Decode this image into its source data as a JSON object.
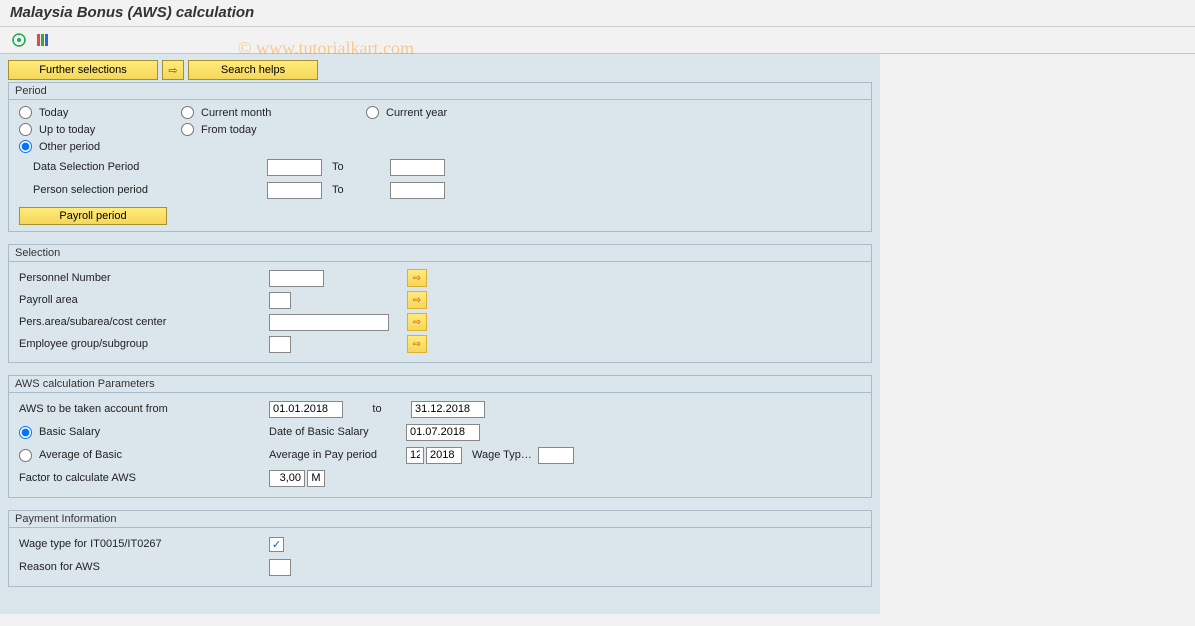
{
  "title": "Malaysia Bonus (AWS) calculation",
  "watermark": "© www.tutorialkart.com",
  "toolbar": {
    "execute_icon": "execute",
    "variant_icon": "variants"
  },
  "top_buttons": {
    "further": "Further selections",
    "search_helps": "Search helps"
  },
  "period": {
    "title": "Period",
    "today": "Today",
    "current_month": "Current month",
    "current_year": "Current year",
    "up_to_today": "Up to today",
    "from_today": "From today",
    "other_period": "Other period",
    "data_sel": "Data Selection Period",
    "person_sel": "Person selection period",
    "to": "To",
    "payroll_btn": "Payroll period",
    "data_from": "",
    "data_to": "",
    "person_from": "",
    "person_to": ""
  },
  "selection": {
    "title": "Selection",
    "personnel_number": "Personnel Number",
    "payroll_area": "Payroll area",
    "pers_area": "Pers.area/subarea/cost center",
    "emp_group": "Employee group/subgroup",
    "pn_val": "",
    "pa_val": "",
    "parea_val": "",
    "eg_val": ""
  },
  "aws_params": {
    "title": "AWS calculation Parameters",
    "aws_from": "AWS to be taken account from",
    "basic_salary": "Basic Salary",
    "average_basic": "Average of Basic",
    "factor": "Factor to calculate AWS",
    "to": "to",
    "date_basic": "Date of Basic Salary",
    "avg_pay": "Average in Pay period",
    "wage_typ": "Wage Typ…",
    "from_date": "01.01.2018",
    "to_date": "31.12.2018",
    "basic_date": "01.07.2018",
    "avg_month": "12",
    "avg_year": "2018",
    "wage_val": "",
    "factor_val": "3,00",
    "factor_unit": "M"
  },
  "payment": {
    "title": "Payment Information",
    "wage_type": "Wage type for IT0015/IT0267",
    "reason": "Reason for AWS",
    "wage_checked": "☑",
    "reason_val": ""
  }
}
